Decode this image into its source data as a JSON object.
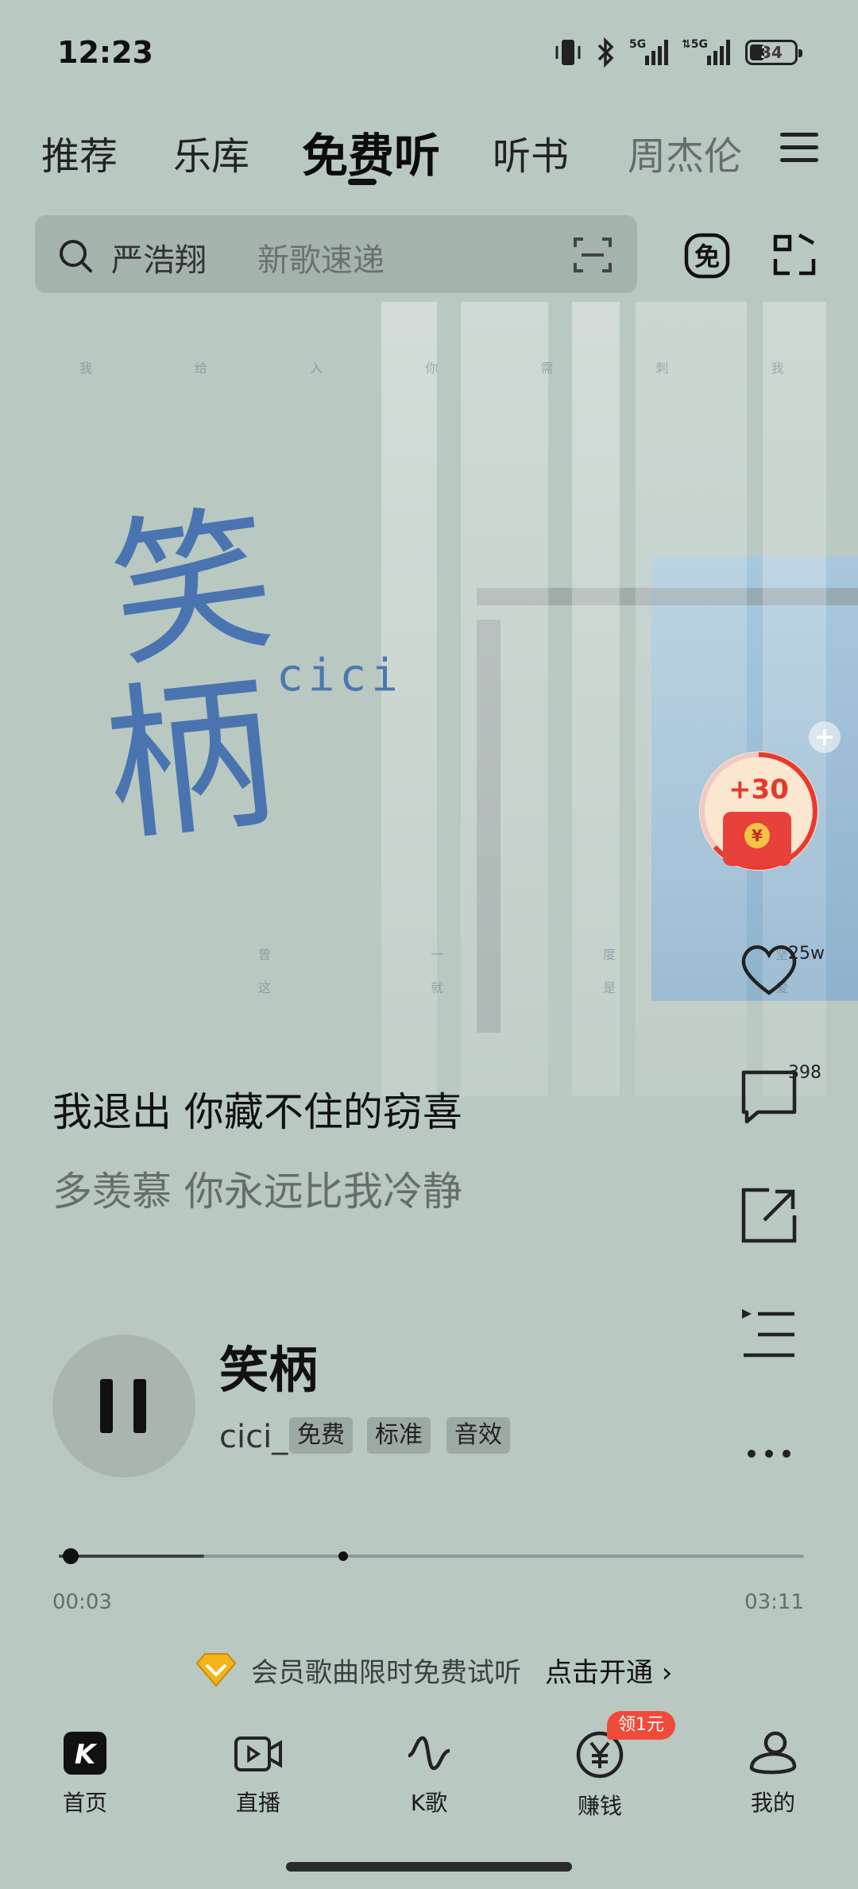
{
  "status_bar": {
    "time": "12:23",
    "battery": "34"
  },
  "tabs": [
    {
      "label": "推荐"
    },
    {
      "label": "乐库"
    },
    {
      "label": "免费听"
    },
    {
      "label": "听书"
    },
    {
      "label": "周杰伦"
    }
  ],
  "search": {
    "hint": "严浩翔",
    "sub_hint": "新歌速递"
  },
  "cover": {
    "title_art": "笑柄",
    "artist_art": "cici",
    "faint_line_1": "我 给 入 你 需 刺 我 的 游 弹",
    "faint_line_2": "曾 一 度 坚 信",
    "faint_line_3": "这 就 是 爱 情"
  },
  "reward": {
    "label": "+30",
    "coin": "¥"
  },
  "rail": {
    "like_count": "25w",
    "comment_count": "398"
  },
  "lyrics": {
    "current": "我退出 你藏不住的窃喜",
    "next": "多羡慕 你永远比我冷静"
  },
  "song": {
    "title": "笑柄",
    "artist": "cici_",
    "tags": [
      "免费",
      "标准",
      "音效"
    ]
  },
  "progress": {
    "current": "00:03",
    "total": "03:11",
    "played_fraction": 0.016,
    "buffered_fraction": 0.12
  },
  "vip": {
    "text": "会员歌曲限时免费试听",
    "cta": "点击开通 ›"
  },
  "nav": {
    "items": [
      {
        "label": "首页"
      },
      {
        "label": "直播"
      },
      {
        "label": "K歌"
      },
      {
        "label": "赚钱"
      },
      {
        "label": "我的"
      }
    ],
    "badge": "领1元"
  },
  "colors": {
    "background": "#b9c8c1",
    "accent_red": "#ef4a3a",
    "cover_blue": "#4b79ae"
  }
}
